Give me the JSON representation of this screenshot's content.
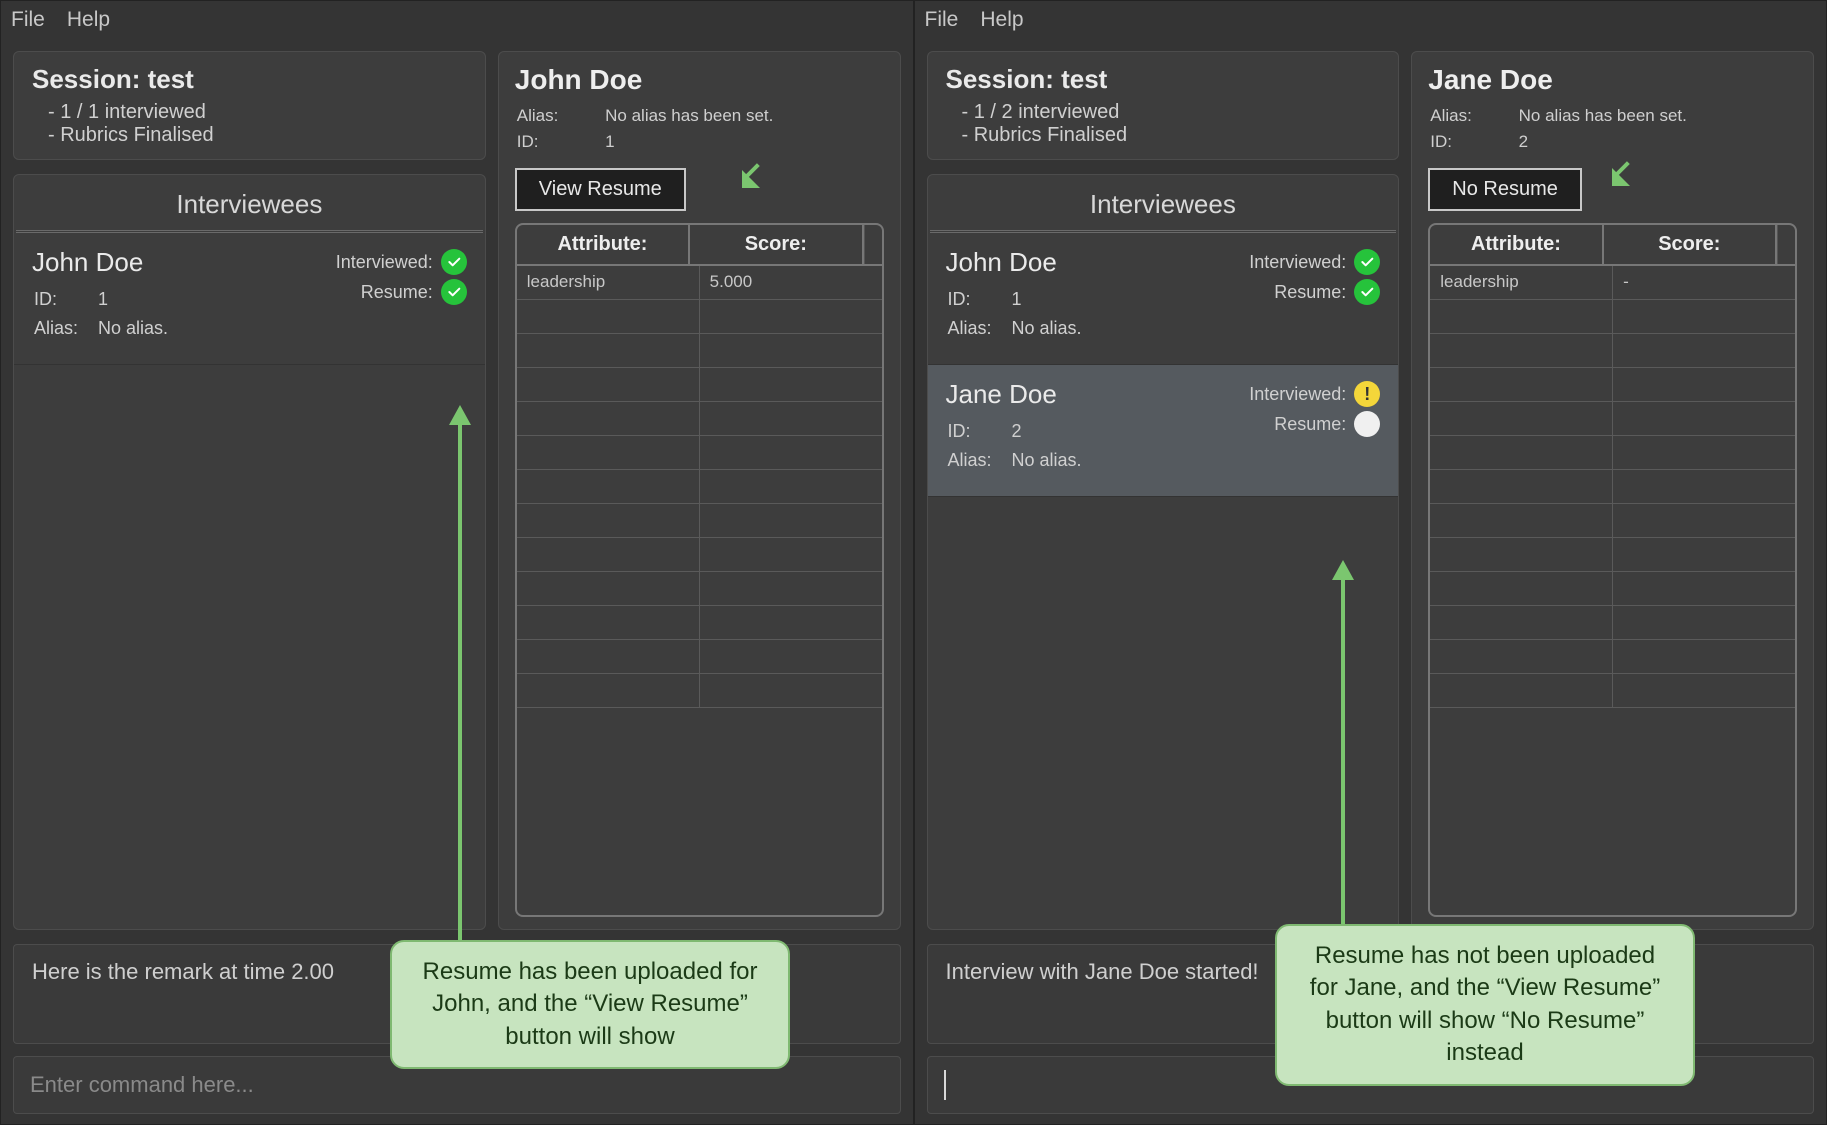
{
  "menu": {
    "file": "File",
    "help": "Help"
  },
  "left": {
    "session": {
      "title": "Session: test",
      "line1": "- 1 / 1 interviewed",
      "line2": "- Rubrics Finalised"
    },
    "interviewees_header": "Interviewees",
    "list": [
      {
        "name": "John Doe",
        "id_label": "ID:",
        "id": "1",
        "alias_label": "Alias:",
        "alias": "No alias.",
        "interviewed_label": "Interviewed:",
        "interviewed_status": "green-check",
        "resume_label": "Resume:",
        "resume_status": "green-check",
        "selected": false
      }
    ],
    "detail": {
      "name": "John Doe",
      "alias_label": "Alias:",
      "alias": "No alias has been set.",
      "id_label": "ID:",
      "id": "1",
      "resume_button": "View Resume",
      "attr_header": "Attribute:",
      "score_header": "Score:",
      "rows": [
        {
          "attr": "leadership",
          "score": "5.000"
        }
      ],
      "blank_rows": 12
    },
    "remark": "Here is the remark at time 2.00",
    "cmd_placeholder": "Enter command here..."
  },
  "right": {
    "session": {
      "title": "Session: test",
      "line1": "- 1 / 2 interviewed",
      "line2": "- Rubrics Finalised"
    },
    "interviewees_header": "Interviewees",
    "list": [
      {
        "name": "John Doe",
        "id_label": "ID:",
        "id": "1",
        "alias_label": "Alias:",
        "alias": "No alias.",
        "interviewed_label": "Interviewed:",
        "interviewed_status": "green-check",
        "resume_label": "Resume:",
        "resume_status": "green-check",
        "selected": false
      },
      {
        "name": "Jane Doe",
        "id_label": "ID:",
        "id": "2",
        "alias_label": "Alias:",
        "alias": "No alias.",
        "interviewed_label": "Interviewed:",
        "interviewed_status": "yellow-warn",
        "resume_label": "Resume:",
        "resume_status": "white-empty",
        "selected": true
      }
    ],
    "detail": {
      "name": "Jane Doe",
      "alias_label": "Alias:",
      "alias": "No alias has been set.",
      "id_label": "ID:",
      "id": "2",
      "resume_button": "No Resume",
      "attr_header": "Attribute:",
      "score_header": "Score:",
      "rows": [
        {
          "attr": "leadership",
          "score": "-"
        }
      ],
      "blank_rows": 12
    },
    "remark": "Interview with Jane Doe started!",
    "cmd_placeholder": ""
  },
  "callouts": {
    "left": "Resume has been uploaded for John, and the “View Resume” button will show",
    "right": "Resume has not been uploaded for Jane, and the “View Resume” button will show “No Resume” instead"
  }
}
